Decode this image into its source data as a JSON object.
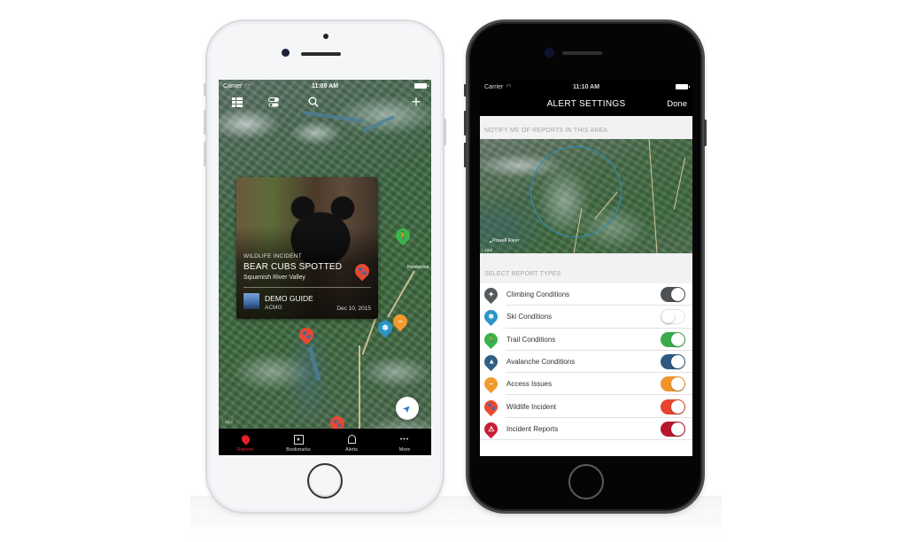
{
  "left_phone": {
    "status_bar": {
      "carrier": "Carrier",
      "time": "11:09 AM"
    },
    "toolbar": {
      "list_icon": "list-icon",
      "filter_icon": "toggle-icon",
      "search_icon": "search-icon",
      "add_icon": "plus-icon",
      "add_glyph": "+"
    },
    "card": {
      "category": "WILDLIFE INCIDENT",
      "title": "BEAR CUBS SPOTTED",
      "location": "Squamish River Valley",
      "guide_name": "DEMO GUIDE",
      "guide_org": "ACMG",
      "date": "Dec 10, 2015",
      "pin_type": "wildlife"
    },
    "map": {
      "place_label": "Pemberton",
      "legal": "Legal",
      "pins": [
        {
          "type": "trail",
          "glyph": "🚶"
        },
        {
          "type": "wildlife",
          "glyph": "🐾"
        },
        {
          "type": "ski",
          "glyph": "❄"
        },
        {
          "type": "access",
          "glyph": "−"
        },
        {
          "type": "wildlife",
          "glyph": "🐾"
        }
      ],
      "locate_glyph": "➤"
    },
    "tab_bar": {
      "tabs": [
        {
          "label": "Reports",
          "icon": "map-marker-icon",
          "active": true
        },
        {
          "label": "Bookmarks",
          "icon": "bookmark-icon",
          "glyph": "★",
          "active": false
        },
        {
          "label": "Alerts",
          "icon": "bell-icon",
          "active": false
        },
        {
          "label": "More",
          "icon": "more-icon",
          "glyph": "•••",
          "active": false
        }
      ]
    }
  },
  "right_phone": {
    "status_bar": {
      "carrier": "Carrier",
      "time": "11:10 AM"
    },
    "header": {
      "title": "ALERT SETTINGS",
      "done_label": "Done"
    },
    "area_section": {
      "header": "NOTIFY ME OF REPORTS IN THIS AREA",
      "place_label": "Powell River",
      "legal": "Legal"
    },
    "types_section": {
      "header": "SELECT REPORT TYPES",
      "items": [
        {
          "label": "Climbing Conditions",
          "icon": "climbing-icon",
          "glyph": "✦",
          "color": "#555a5c",
          "enabled": true,
          "switch_color": "#4d5153"
        },
        {
          "label": "Ski Conditions",
          "icon": "ski-icon",
          "glyph": "❄",
          "color": "#2b95c8",
          "enabled": false,
          "switch_color": "#2b95c8"
        },
        {
          "label": "Trail Conditions",
          "icon": "trail-icon",
          "glyph": "🚶",
          "color": "#3ab54a",
          "enabled": true,
          "switch_color": "#3aab4a"
        },
        {
          "label": "Avalanche Conditions",
          "icon": "avalanche-icon",
          "glyph": "▲",
          "color": "#2f5f86",
          "enabled": true,
          "switch_color": "#2f5a80"
        },
        {
          "label": "Access Issues",
          "icon": "access-icon",
          "glyph": "−",
          "color": "#f29a2e",
          "enabled": true,
          "switch_color": "#f0942b"
        },
        {
          "label": "Wildlife Incident",
          "icon": "wildlife-icon",
          "glyph": "🐾",
          "color": "#e9492f",
          "enabled": true,
          "switch_color": "#e64430"
        },
        {
          "label": "Incident Reports",
          "icon": "warning-icon",
          "glyph": "⚠",
          "color": "#c41f35",
          "enabled": true,
          "switch_color": "#b8162c"
        }
      ]
    }
  }
}
